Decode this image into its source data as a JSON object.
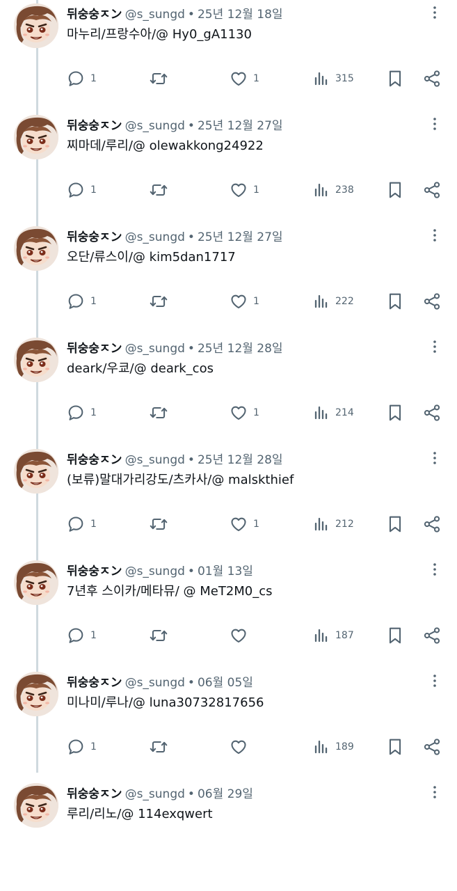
{
  "colors": {
    "text": "#0f1419",
    "secondary": "#536471",
    "thread_line": "#cfd9de"
  },
  "icons": {
    "more": "more-icon",
    "reply": "reply-icon",
    "retweet": "retweet-icon",
    "like": "heart-icon",
    "views": "views-icon",
    "bookmark": "bookmark-icon",
    "share": "share-icon"
  },
  "tweets": [
    {
      "name": "뒤숭숭ㅈン",
      "handle": "@s_sungd",
      "date": "25년 12월 18일",
      "text": "마누리/프랑수아/@ Hy0_gA1130",
      "replies": "1",
      "likes": "1",
      "views": "315"
    },
    {
      "name": "뒤숭숭ㅈン",
      "handle": "@s_sungd",
      "date": "25년 12월 27일",
      "text": "찌마데/루리/@ olewakkong24922",
      "replies": "1",
      "likes": "1",
      "views": "238"
    },
    {
      "name": "뒤숭숭ㅈン",
      "handle": "@s_sungd",
      "date": "25년 12월 27일",
      "text": "오단/류스이/@ kim5dan1717",
      "replies": "1",
      "likes": "1",
      "views": "222"
    },
    {
      "name": "뒤숭숭ㅈン",
      "handle": "@s_sungd",
      "date": "25년 12월 28일",
      "text": "deark/우쿄/@ deark_cos",
      "replies": "1",
      "likes": "1",
      "views": "214"
    },
    {
      "name": "뒤숭숭ㅈン",
      "handle": "@s_sungd",
      "date": "25년 12월 28일",
      "text": "(보류)말대가리강도/츠카사/@ malskthief",
      "replies": "1",
      "likes": "1",
      "views": "212"
    },
    {
      "name": "뒤숭숭ㅈン",
      "handle": "@s_sungd",
      "date": "01월 13일",
      "text": "7년후 스이카/메타뮤/ @ MeT2M0_cs",
      "replies": "1",
      "likes": "",
      "views": "187"
    },
    {
      "name": "뒤숭숭ㅈン",
      "handle": "@s_sungd",
      "date": "06월 05일",
      "text": "미나미/루나/@ luna30732817656",
      "replies": "1",
      "likes": "",
      "views": "189"
    },
    {
      "name": "뒤숭숭ㅈン",
      "handle": "@s_sungd",
      "date": "06월 29일",
      "text": "루리/리노/@ 114exqwert",
      "replies": "",
      "likes": "",
      "views": ""
    }
  ]
}
